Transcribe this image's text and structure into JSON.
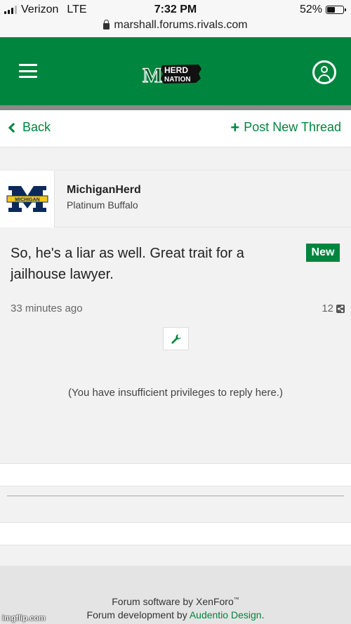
{
  "status_bar": {
    "carrier": "Verizon",
    "network": "LTE",
    "time": "7:32 PM",
    "battery": "52%",
    "battery_level": 0.52,
    "url": "marshall.forums.rivals.com"
  },
  "header": {
    "logo_text_top": "HERD",
    "logo_text_bottom": "NATION",
    "logo_letter": "M",
    "brand_color": "#00853e",
    "menu_icon": "hamburger-icon",
    "account_icon": "user-icon"
  },
  "nav": {
    "back_label": "Back",
    "post_thread_label": "Post New Thread"
  },
  "post": {
    "avatar_text": "MICHIGAN",
    "username": "MichiganHerd",
    "user_title": "Platinum Buffalo",
    "message": "So, he's a liar as well. Great trait for a jailhouse lawyer.",
    "badge": "New",
    "time": "33 minutes ago",
    "post_number": "12",
    "tools_icon": "wrench-icon"
  },
  "notice": "(You have insufficient privileges to reply here.)",
  "footer": {
    "software_prefix": "Forum software by XenForo",
    "trademark": "™",
    "dev_prefix": "Forum development by",
    "dev_link": "Audentio Design",
    "dev_suffix": "."
  },
  "watermark": "imgflip.com"
}
